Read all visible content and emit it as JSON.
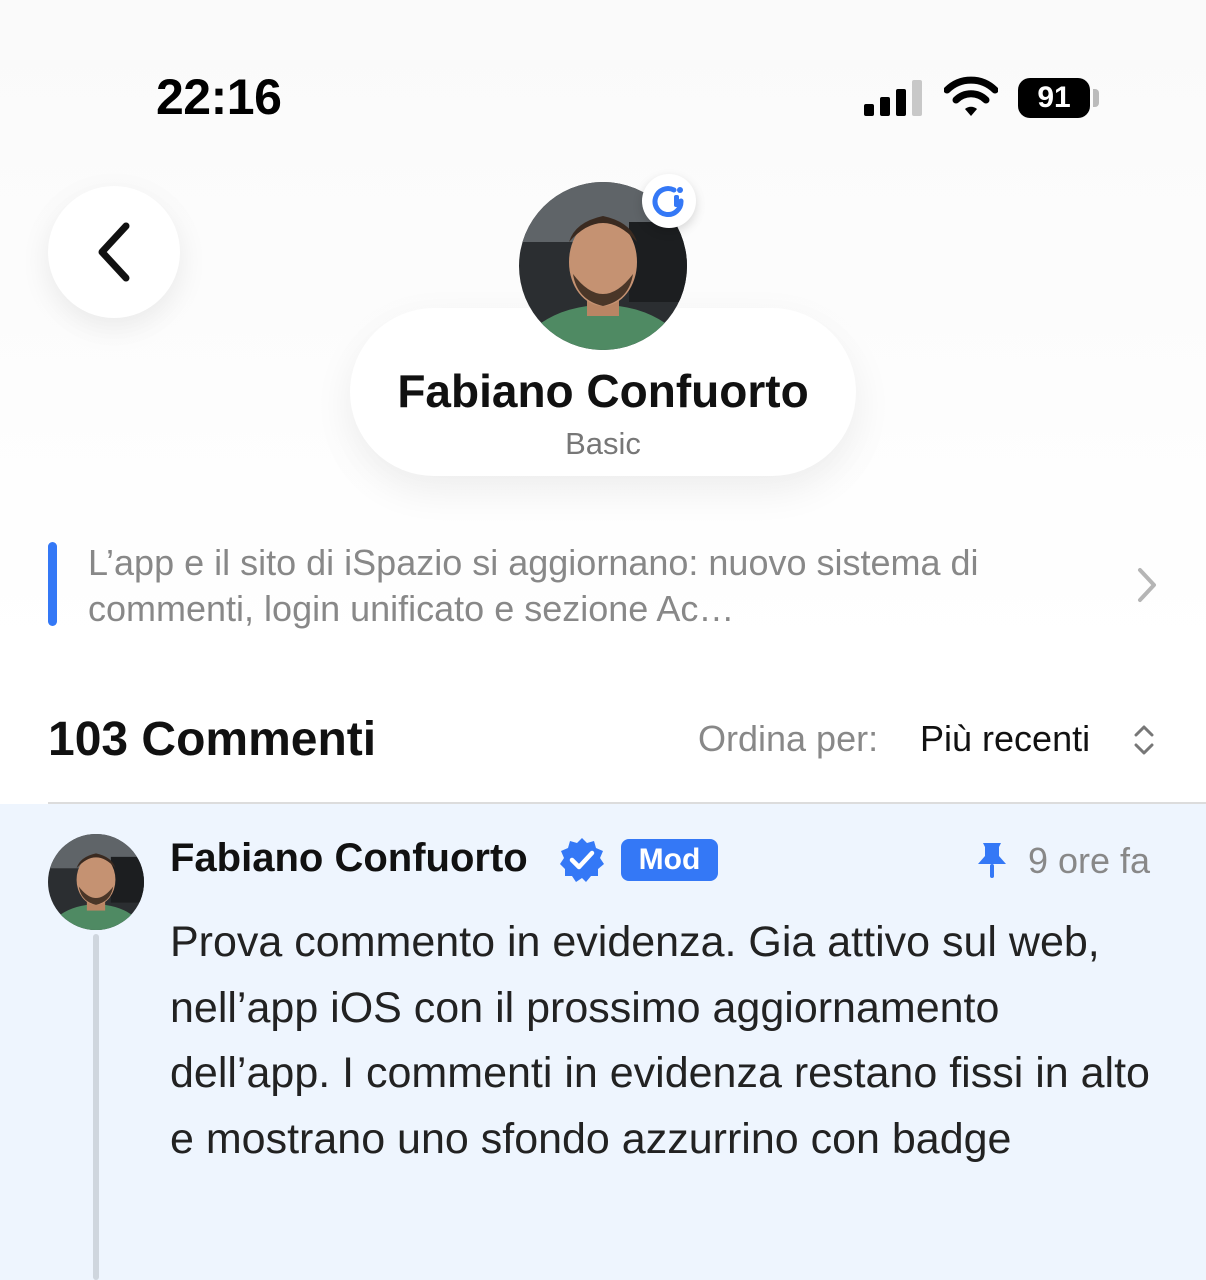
{
  "status_bar": {
    "time": "22:16",
    "battery": "91"
  },
  "profile": {
    "name": "Fabiano Confuorto",
    "plan": "Basic"
  },
  "article": {
    "title": "L’app e il sito di iSpazio si aggiornano: nuovo sistema di commenti, login unificato e sezione Ac…"
  },
  "comments": {
    "count_label": "103 Commenti",
    "sort_label": "Ordina per:",
    "sort_value": "Più recenti"
  },
  "pinned_comment": {
    "author": "Fabiano Confuorto",
    "badge": "Mod",
    "time": "9 ore fa",
    "body": "Prova commento in evidenza. Gia attivo sul web, nell’app iOS con il prossimo aggiornamento dell’app. I commenti in evidenza restano fissi in alto e mostrano uno sfondo azzurrino con badge"
  },
  "colors": {
    "accent": "#3478f6",
    "pinned_background": "#eef5fe",
    "secondary_text": "#888888"
  },
  "icons": [
    "cellular-signal-icon",
    "wifi-icon",
    "battery-icon",
    "back-chevron-icon",
    "ispazio-logo-icon",
    "chevron-right-icon",
    "sort-updown-icon",
    "verified-icon",
    "pin-icon"
  ]
}
